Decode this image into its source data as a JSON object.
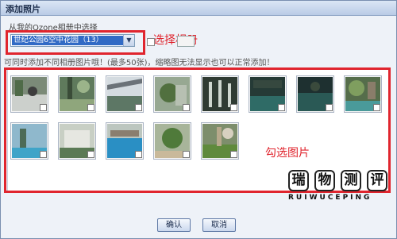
{
  "dialog": {
    "title": "添加照片",
    "source_label": "从我的Qzone相册中选择",
    "album_selected": "世纪公园6空中花园（13）",
    "hint": "可同时添加不同相册图片哦！(最多50张)，缩略图无法显示也可以正常添加！",
    "ok_label": "确认",
    "cancel_label": "取消"
  },
  "annotations": {
    "select_album": "选择相册",
    "check_photos": "勾选图片"
  },
  "logo": {
    "chars": [
      "瑞",
      "物",
      "测",
      "评"
    ],
    "sub": "RUIWUCEPING"
  },
  "photos": [
    {
      "name": "photo-1"
    },
    {
      "name": "photo-2"
    },
    {
      "name": "photo-3"
    },
    {
      "name": "photo-4"
    },
    {
      "name": "photo-5"
    },
    {
      "name": "photo-6"
    },
    {
      "name": "photo-7"
    },
    {
      "name": "photo-8"
    },
    {
      "name": "photo-9"
    },
    {
      "name": "photo-10"
    },
    {
      "name": "photo-11"
    },
    {
      "name": "photo-12"
    },
    {
      "name": "photo-13"
    }
  ],
  "colors": {
    "annotation_red": "#e0252e",
    "selection_blue": "#316ac5"
  }
}
